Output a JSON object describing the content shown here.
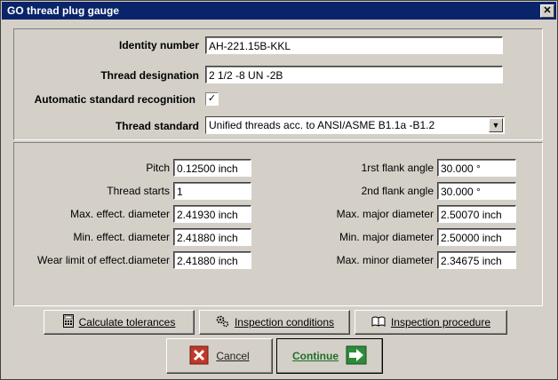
{
  "window": {
    "title": "GO thread plug gauge",
    "close_glyph": "✕"
  },
  "top_form": {
    "identity_label": "Identity number",
    "identity_value": "AH-221.15B-KKL",
    "thread_designation_label": "Thread designation",
    "thread_designation_value": "2 1/2 -8 UN  -2B",
    "auto_recognition_label": "Automatic standard recognition",
    "auto_recognition_checked": "✓",
    "thread_standard_label": "Thread standard",
    "thread_standard_value": "Unified threads acc. to ANSI/ASME B1.1a -B1.2"
  },
  "params_left": [
    {
      "label": "Pitch",
      "value": "0.12500 inch"
    },
    {
      "label": "Thread starts",
      "value": "1"
    },
    {
      "label": "Max. effect. diameter",
      "value": "2.41930 inch"
    },
    {
      "label": "Min. effect. diameter",
      "value": "2.41880 inch"
    },
    {
      "label": "Wear limit of effect.diameter",
      "value": "2.41880 inch"
    }
  ],
  "params_right": [
    {
      "label": "1rst flank angle",
      "value": "30.000 °"
    },
    {
      "label": "2nd flank angle",
      "value": "30.000 °"
    },
    {
      "label": "Max. major diameter",
      "value": "2.50070 inch"
    },
    {
      "label": "Min. major diameter",
      "value": "2.50000 inch"
    },
    {
      "label": "Max. minor diameter",
      "value": "2.34675 inch"
    }
  ],
  "buttons": {
    "calculate": "Calculate tolerances",
    "inspection_conditions": "Inspection conditions",
    "inspection_procedure": "Inspection procedure",
    "cancel": "Cancel",
    "continue": "Continue"
  },
  "colors": {
    "title_bar": "#0a246a",
    "cancel_icon": "#c0392b",
    "continue_icon": "#2e8b3a",
    "continue_text": "#1f6e2a"
  }
}
